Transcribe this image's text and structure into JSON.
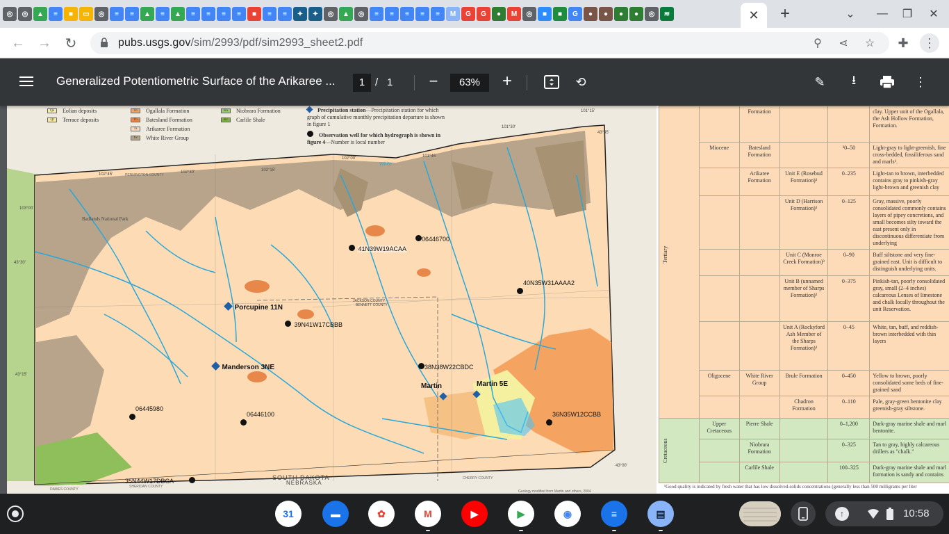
{
  "browser": {
    "tabs": [
      {
        "icon": "chrome-icon",
        "color": "#5f6368",
        "glyph": "◎"
      },
      {
        "icon": "chrome-icon",
        "color": "#5f6368",
        "glyph": "◎"
      },
      {
        "icon": "drive-icon",
        "color": "#34a853",
        "glyph": "▲"
      },
      {
        "icon": "docs-icon",
        "color": "#4285f4",
        "glyph": "≡"
      },
      {
        "icon": "image-icon",
        "color": "#f6b400",
        "glyph": "■"
      },
      {
        "icon": "slides-icon",
        "color": "#f4b400",
        "glyph": "▭"
      },
      {
        "icon": "chrome-icon",
        "color": "#5f6368",
        "glyph": "◎"
      },
      {
        "icon": "docs-icon",
        "color": "#4285f4",
        "glyph": "≡"
      },
      {
        "icon": "docs-icon",
        "color": "#4285f4",
        "glyph": "≡"
      },
      {
        "icon": "drive-icon",
        "color": "#34a853",
        "glyph": "▲"
      },
      {
        "icon": "docs-icon",
        "color": "#4285f4",
        "glyph": "≡"
      },
      {
        "icon": "drive-icon",
        "color": "#34a853",
        "glyph": "▲"
      },
      {
        "icon": "docs-icon",
        "color": "#4285f4",
        "glyph": "≡"
      },
      {
        "icon": "docs-icon",
        "color": "#4285f4",
        "glyph": "≡"
      },
      {
        "icon": "docs-icon",
        "color": "#4285f4",
        "glyph": "≡"
      },
      {
        "icon": "docs-icon",
        "color": "#4285f4",
        "glyph": "≡"
      },
      {
        "icon": "pdf-icon",
        "color": "#ea4335",
        "glyph": "■"
      },
      {
        "icon": "docs-icon",
        "color": "#4285f4",
        "glyph": "≡"
      },
      {
        "icon": "docs-icon",
        "color": "#4285f4",
        "glyph": "≡"
      },
      {
        "icon": "usgs-icon",
        "color": "#1a5e8a",
        "glyph": "✦"
      },
      {
        "icon": "usgs-icon",
        "color": "#1a5e8a",
        "glyph": "✦"
      },
      {
        "icon": "chrome-icon",
        "color": "#5f6368",
        "glyph": "◎"
      },
      {
        "icon": "drive-icon",
        "color": "#34a853",
        "glyph": "▲"
      },
      {
        "icon": "chrome-icon",
        "color": "#5f6368",
        "glyph": "◎"
      },
      {
        "icon": "docs-icon",
        "color": "#4285f4",
        "glyph": "≡"
      },
      {
        "icon": "docs-icon",
        "color": "#4285f4",
        "glyph": "≡"
      },
      {
        "icon": "docs-icon",
        "color": "#4285f4",
        "glyph": "≡"
      },
      {
        "icon": "docs-icon",
        "color": "#4285f4",
        "glyph": "≡"
      },
      {
        "icon": "docs-icon",
        "color": "#4285f4",
        "glyph": "≡"
      },
      {
        "icon": "my-icon",
        "color": "#8ab4f8",
        "glyph": "M"
      },
      {
        "icon": "google-icon",
        "color": "#ea4335",
        "glyph": "G"
      },
      {
        "icon": "google-icon",
        "color": "#ea4335",
        "glyph": "G"
      },
      {
        "icon": "seal-icon",
        "color": "#2e7d32",
        "glyph": "●"
      },
      {
        "icon": "gmail-icon",
        "color": "#ea4335",
        "glyph": "M"
      },
      {
        "icon": "chrome-icon",
        "color": "#5f6368",
        "glyph": "◎"
      },
      {
        "icon": "zoom-icon",
        "color": "#2d8cff",
        "glyph": "■"
      },
      {
        "icon": "classroom-icon",
        "color": "#1e8e3e",
        "glyph": "■"
      },
      {
        "icon": "google-icon",
        "color": "#4285f4",
        "glyph": "G"
      },
      {
        "icon": "seal-icon",
        "color": "#795548",
        "glyph": "●"
      },
      {
        "icon": "seal-icon",
        "color": "#795548",
        "glyph": "●"
      },
      {
        "icon": "circle-icon",
        "color": "#2e7d32",
        "glyph": "●"
      },
      {
        "icon": "circle-icon",
        "color": "#2e7d32",
        "glyph": "●"
      },
      {
        "icon": "chrome-icon",
        "color": "#5f6368",
        "glyph": "◎"
      },
      {
        "icon": "chart-icon",
        "color": "#0b7a3b",
        "glyph": "≋"
      }
    ],
    "active_tab_close": "✕",
    "new_tab": "+",
    "url_host": "pubs.usgs.gov",
    "url_path": "/sim/2993/pdf/sim2993_sheet2.pdf"
  },
  "pdf": {
    "title": "Generalized Potentiometric Surface of the Arikaree ...",
    "page_current": "1",
    "page_separator": "/",
    "page_total": "1",
    "zoom": "63%"
  },
  "legend": {
    "items": [
      {
        "code": "Qe",
        "label": "Eolian deposits",
        "color": "#f5f0a0"
      },
      {
        "code": "Qt",
        "label": "Terrace deposits",
        "color": "#fbe9a8"
      },
      {
        "code": "To",
        "label": "Ogallala Formation",
        "color": "#f4a460"
      },
      {
        "code": "Tb",
        "label": "Batesland Formation",
        "color": "#e8874a"
      },
      {
        "code": "Ta",
        "label": "Arikaree Formation",
        "color": "#fddcb5"
      },
      {
        "code": "Tw",
        "label": "White River Group",
        "color": "#b8a48a"
      },
      {
        "code": "Kn",
        "label": "Niobrara Formation",
        "color": "#9ccc65"
      },
      {
        "code": "Kc",
        "label": "Carlile Shale",
        "color": "#7cb342"
      }
    ],
    "precip_title": "Precipitation station",
    "precip_desc": "—Precipitation station for which graph of cumulative monthly precipitation departure is shown in figure 1",
    "obs_title": "Observation well for which hydrograph is shown in figure 4",
    "obs_desc": "—Number is local number"
  },
  "map": {
    "wells": [
      {
        "label": "41N39W19ACAA"
      },
      {
        "label": "06446700"
      },
      {
        "label": "40N35W31AAAA2"
      },
      {
        "label": "39N41W17CBBB"
      },
      {
        "label": "38N38W22CBDC"
      },
      {
        "label": "06445980"
      },
      {
        "label": "06446100"
      },
      {
        "label": "36N35W12CCBB"
      },
      {
        "label": "35N44W17DBCA"
      }
    ],
    "stations": [
      {
        "label": "Porcupine 11N"
      },
      {
        "label": "Manderson 3NE"
      },
      {
        "label": "Martin"
      },
      {
        "label": "Martin 5E"
      }
    ],
    "places": [
      {
        "label": "Badlands National Park"
      },
      {
        "label": "PENNINGTON COUNTY"
      },
      {
        "label": "JACKSON COUNTY"
      },
      {
        "label": "BENNETT COUNTY"
      },
      {
        "label": "SOUTH DAKOTA"
      },
      {
        "label": "NEBRASKA"
      },
      {
        "label": "DAWES COUNTY"
      },
      {
        "label": "SHERIDAN COUNTY"
      },
      {
        "label": "CHERRY COUNTY"
      },
      {
        "label": "White"
      }
    ],
    "graticule": [
      {
        "label": "102°45'"
      },
      {
        "label": "102°30'"
      },
      {
        "label": "102°15'"
      },
      {
        "label": "102°00'"
      },
      {
        "label": "101°45'"
      },
      {
        "label": "101°30'"
      },
      {
        "label": "101°15'"
      },
      {
        "label": "103°00'"
      },
      {
        "label": "43°45'"
      },
      {
        "label": "43°30'"
      },
      {
        "label": "43°15'"
      },
      {
        "label": "43°00'"
      }
    ],
    "credit": "Geology modified from Martin and others, 2004"
  },
  "strat": {
    "rows": [
      {
        "epoch": "",
        "group": "Formation",
        "unit": "",
        "thick": "",
        "desc": "clay. Upper unit of the Ogallala, the Ash Hollow Formation, Formation."
      },
      {
        "epoch": "Miocene",
        "group": "Batesland Formation",
        "unit": "",
        "thick": "³0–50",
        "desc": "Light-gray to light-greenish, fine cross-bedded, fossiliferous sand and marls¹."
      },
      {
        "epoch": "",
        "group": "Arikaree Formation",
        "unit": "Unit E (Rosebud Formation)³",
        "thick": "0–235",
        "desc": "Light-tan to brown, interbedded contains gray to pinkish-gray light-brown and greenish clay"
      },
      {
        "epoch": "",
        "group": "",
        "unit": "Unit D (Harrison Formation)³",
        "thick": "0–125",
        "desc": "Gray, massive, poorly consolidated commonly contains layers of pipey concretions, and small becomes silty toward the east present only in discontinuous differentiate from underlying"
      },
      {
        "epoch": "",
        "group": "",
        "unit": "Unit C (Monroe Creek Formation)³",
        "thick": "0–90",
        "desc": "Buff siltstone and very fine-grained east. Unit is difficult to distinguish underlying units."
      },
      {
        "epoch": "",
        "group": "",
        "unit": "Unit B (unnamed member of Sharps Formation)³",
        "thick": "0–375",
        "desc": "Pinkish-tan, poorly consolidated gray, small (2–4 inches) calcareous Lenses of limestone and chalk locally throughout the unit Reservation."
      },
      {
        "epoch": "",
        "group": "",
        "unit": "Unit A (Rockyford Ash Member of the Sharps Formation)³",
        "thick": "0–45",
        "desc": "White, tan, buff, and reddish-brown interbedded with thin layers"
      },
      {
        "epoch": "Oligocene",
        "group": "White River Group",
        "unit": "Brule Formation",
        "thick": "0–450",
        "desc": "Yellow to brown, poorly consolidated some beds of fine-grained sand"
      },
      {
        "epoch": "",
        "group": "",
        "unit": "Chadron Formation",
        "thick": "0–110",
        "desc": "Pale, gray-green bentonite clay greenish-gray siltstone."
      },
      {
        "epoch": "Upper Cretaceous",
        "group": "Pierre Shale",
        "unit": "",
        "thick": "0–1,200",
        "desc": "Dark-gray marine shale and marl bentonite."
      },
      {
        "epoch": "",
        "group": "Niobrara Formation",
        "unit": "",
        "thick": "0–325",
        "desc": "Tan to gray, highly calcareous drillers as \"chalk.\""
      },
      {
        "epoch": "",
        "group": "Carlile Shale",
        "unit": "",
        "thick": "100–325",
        "desc": "Dark-gray marine shale and marl formation is sandy and contains"
      }
    ],
    "era_tertiary": "Tertiary",
    "era_cretaceous": "Cretaceous",
    "footnote": "¹Good quality is indicated by fresh water that has low dissolved-solids concentrations (generally less than 500 milligrams per liter"
  },
  "shelf": {
    "apps": [
      {
        "name": "calendar-app",
        "glyph": "31",
        "color": "#fff",
        "text": "#1a73e8"
      },
      {
        "name": "files-app",
        "glyph": "▬",
        "color": "#1a73e8",
        "text": "#fff"
      },
      {
        "name": "photos-app",
        "glyph": "✿",
        "color": "#fff",
        "text": "#ea4335"
      },
      {
        "name": "gmail-app",
        "glyph": "M",
        "color": "#fff",
        "text": "#ea4335"
      },
      {
        "name": "youtube-app",
        "glyph": "▶",
        "color": "#ff0000",
        "text": "#fff"
      },
      {
        "name": "play-store-app",
        "glyph": "▶",
        "color": "#fff",
        "text": "#34a853"
      },
      {
        "name": "chrome-app",
        "glyph": "◉",
        "color": "#fff",
        "text": "#4285f4"
      },
      {
        "name": "messages-app",
        "glyph": "≡",
        "color": "#1a73e8",
        "text": "#fff"
      },
      {
        "name": "print-app",
        "glyph": "▤",
        "color": "#8ab4f8",
        "text": "#1f2022"
      }
    ],
    "time": "10:58"
  }
}
